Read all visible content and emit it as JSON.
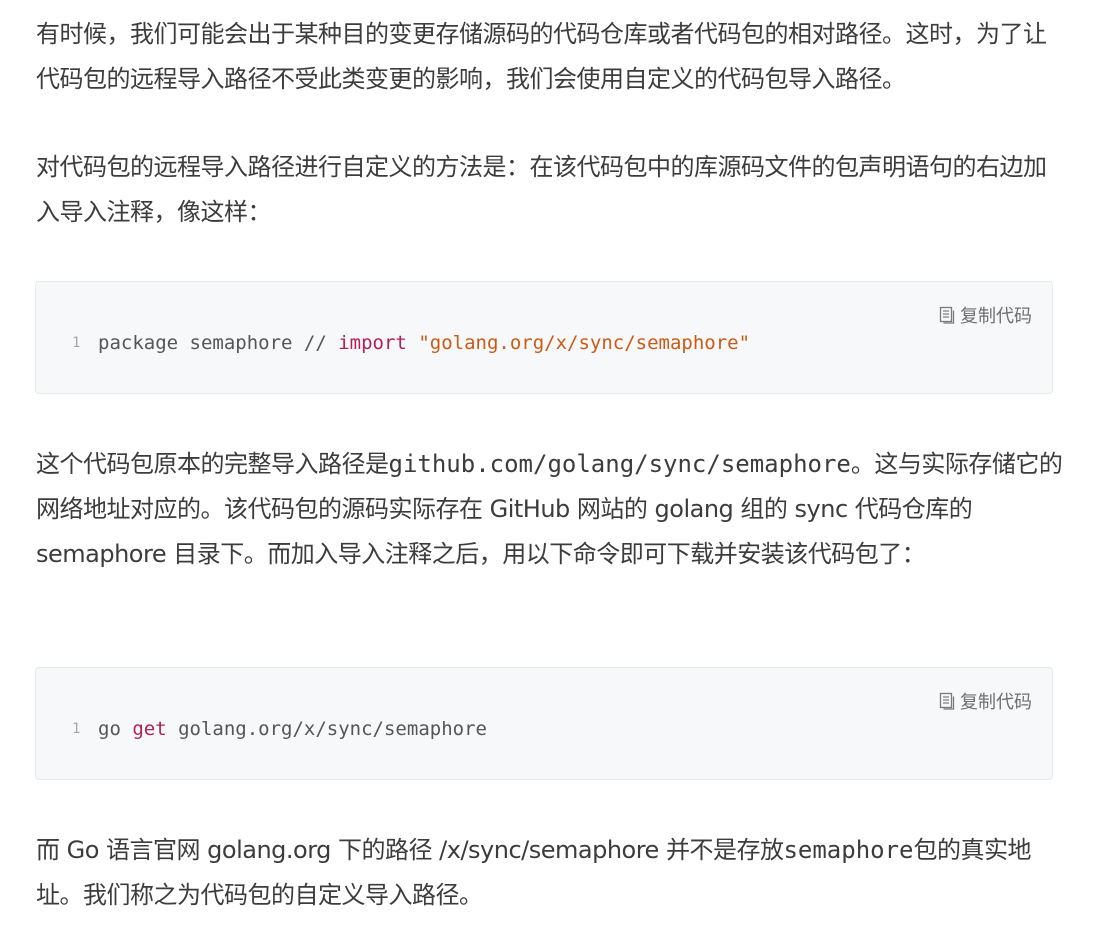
{
  "paragraphs": {
    "p1": "有时候，我们可能会出于某种目的变更存储源码的代码仓库或者代码包的相对路径。这时，为了让代码包的远程导入路径不受此类变更的影响，我们会使用自定义的代码包导入路径。",
    "p2": "对代码包的远程导入路径进行自定义的方法是：在该代码包中的库源码文件的包声明语句的右边加入导入注释，像这样：",
    "p3_before": "这个代码包原本的完整导入路径是",
    "p3_code": "github.com/golang/sync/semaphore",
    "p3_after": "。这与实际存储它的网络地址对应的。该代码包的源码实际存在 GitHub 网站的 golang 组的 sync 代码仓库的 semaphore 目录下。而加入导入注释之后，用以下命令即可下载并安装该代码包了：",
    "p4_before": "而 Go 语言官网 golang.org 下的路径 /x/sync/semaphore 并不是存放",
    "p4_code": "semaphore",
    "p4_after": "包的真实地址。我们称之为代码包的自定义导入路径。"
  },
  "code_blocks": [
    {
      "copy_label": "复制代码",
      "line_number": "1",
      "tokens": {
        "t1": "package semaphore // ",
        "t2": "import",
        "t3": " ",
        "t4": "\"golang.org/x/sync/semaphore\""
      }
    },
    {
      "copy_label": "复制代码",
      "line_number": "1",
      "tokens": {
        "t1": "go ",
        "t2": "get",
        "t3": " golang.org/x/sync/semaphore"
      }
    }
  ],
  "colors": {
    "text": "#3c3c3c",
    "code_background": "#f7f8fa",
    "keyword": "#b0205a",
    "string": "#cc5a16",
    "line_number": "#a8a8a8"
  },
  "icons": {
    "copy": "copy-document-icon"
  }
}
